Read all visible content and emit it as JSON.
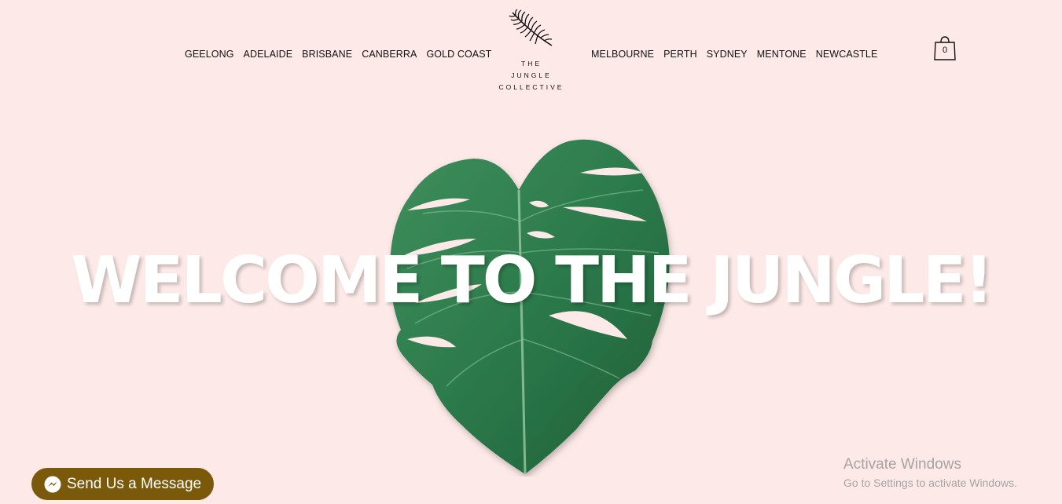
{
  "nav_left": [
    "GEELONG",
    "ADELAIDE",
    "BRISBANE",
    "CANBERRA",
    "GOLD COAST"
  ],
  "nav_right": [
    "MELBOURNE",
    "PERTH",
    "SYDNEY",
    "MENTONE",
    "NEWCASTLE"
  ],
  "logo": {
    "line1": "THE",
    "line2": "JUNGLE",
    "line3": "COLLECTIVE",
    "icon": "palm-leaf-icon"
  },
  "cart": {
    "count": "0",
    "icon": "shopping-bag-icon"
  },
  "hero": {
    "title": "WELCOME TO THE JUNGLE!",
    "image": "monstera-leaf"
  },
  "message_button": {
    "label": "Send Us a Message",
    "icon": "messenger-icon",
    "color": "#7a5a0a"
  },
  "windows_watermark": {
    "title": "Activate Windows",
    "subtitle": "Go to Settings to activate Windows."
  },
  "colors": {
    "background": "#fdeae8",
    "leaf": "#2e7d4f",
    "hero_text": "#ffffff"
  }
}
